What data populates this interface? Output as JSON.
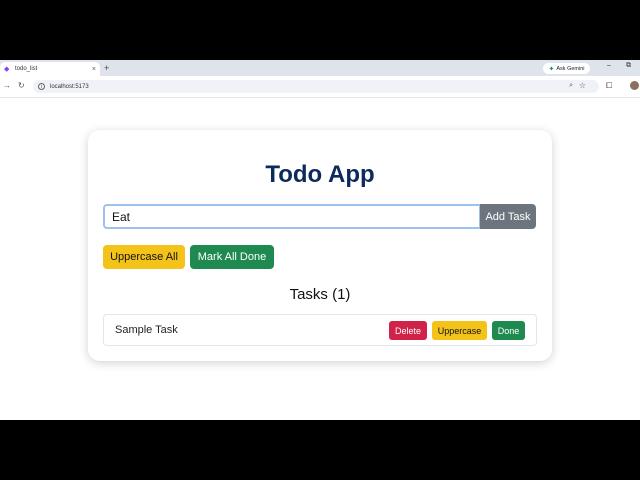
{
  "browser": {
    "tab_title": "todo_list",
    "tab_close": "×",
    "new_tab": "+",
    "gemini_label": "Ask Gemini",
    "url": "localhost:5173",
    "minimize": "–",
    "restore": "⧉"
  },
  "app": {
    "title": "Todo App",
    "input_value": "Eat",
    "add_button": "Add Task",
    "uppercase_all_button": "Uppercase All",
    "mark_all_done_button": "Mark All Done",
    "tasks_heading": "Tasks (1)",
    "tasks": [
      {
        "text": "Sample Task",
        "delete_label": "Delete",
        "uppercase_label": "Uppercase",
        "done_label": "Done"
      }
    ]
  },
  "colors": {
    "title": "#0c2a5b",
    "add": "#6c757d",
    "warning": "#f3c319",
    "success": "#1f8a4f",
    "danger": "#d0234a"
  }
}
